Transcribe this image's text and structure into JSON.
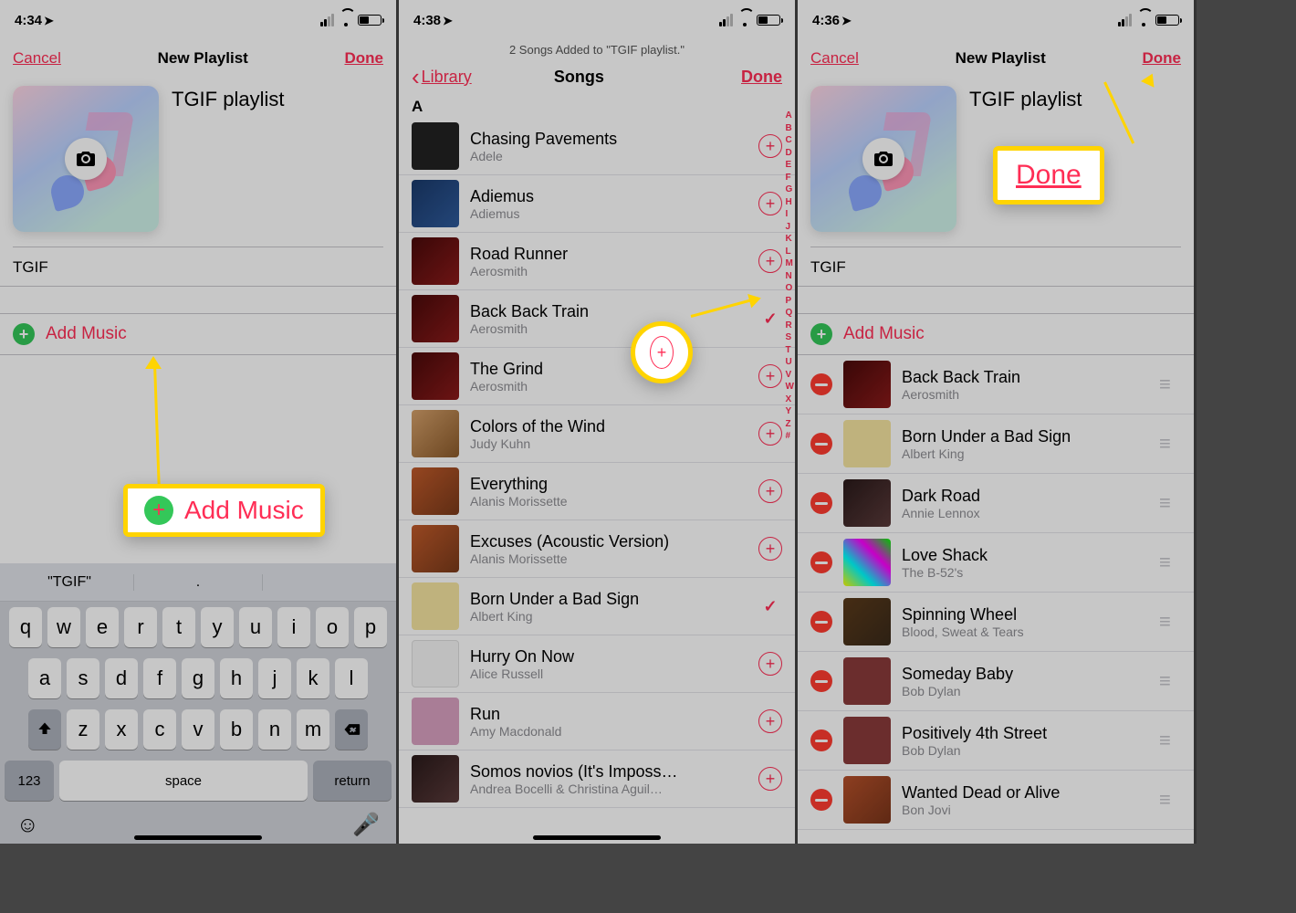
{
  "screens": {
    "s1": {
      "status_time": "4:34",
      "nav": {
        "cancel": "Cancel",
        "title": "New Playlist",
        "done": "Done"
      },
      "playlist_title": "TGIF playlist",
      "description": "TGIF",
      "add_music": "Add Music",
      "callout_add_music": "Add Music",
      "keyboard": {
        "suggestion": "\"TGIF\"",
        "row1": [
          "q",
          "w",
          "e",
          "r",
          "t",
          "y",
          "u",
          "i",
          "o",
          "p"
        ],
        "row2": [
          "a",
          "s",
          "d",
          "f",
          "g",
          "h",
          "j",
          "k",
          "l"
        ],
        "row3": [
          "z",
          "x",
          "c",
          "v",
          "b",
          "n",
          "m"
        ],
        "key_123": "123",
        "key_space": "space",
        "key_return": "return"
      }
    },
    "s2": {
      "status_time": "4:38",
      "toast": "2 Songs Added to \"TGIF playlist.\"",
      "nav": {
        "back": "Library",
        "title": "Songs",
        "done": "Done"
      },
      "section": "A",
      "index": [
        "A",
        "B",
        "C",
        "D",
        "E",
        "F",
        "G",
        "H",
        "I",
        "J",
        "K",
        "L",
        "M",
        "N",
        "O",
        "P",
        "Q",
        "R",
        "S",
        "T",
        "U",
        "V",
        "W",
        "X",
        "Y",
        "Z",
        "#"
      ],
      "songs": [
        {
          "title": "Chasing Pavements",
          "artist": "Adele",
          "state": "add",
          "thumb": "t-adele"
        },
        {
          "title": "Adiemus",
          "artist": "Adiemus",
          "state": "add",
          "thumb": "t-blue"
        },
        {
          "title": "Road Runner",
          "artist": "Aerosmith",
          "state": "add",
          "thumb": "t-red"
        },
        {
          "title": "Back Back Train",
          "artist": "Aerosmith",
          "state": "added",
          "thumb": "t-red"
        },
        {
          "title": "The Grind",
          "artist": "Aerosmith",
          "state": "add",
          "thumb": "t-red"
        },
        {
          "title": "Colors of the Wind",
          "artist": "Judy Kuhn",
          "state": "add",
          "thumb": "t-poca"
        },
        {
          "title": "Everything",
          "artist": "Alanis Morissette",
          "state": "add",
          "thumb": "t-alanis"
        },
        {
          "title": "Excuses (Acoustic Version)",
          "artist": "Alanis Morissette",
          "state": "add",
          "thumb": "t-alanis"
        },
        {
          "title": "Born Under a Bad Sign",
          "artist": "Albert King",
          "state": "added",
          "thumb": "t-king"
        },
        {
          "title": "Hurry On Now",
          "artist": "Alice Russell",
          "state": "add",
          "thumb": "t-white"
        },
        {
          "title": "Run",
          "artist": "Amy Macdonald",
          "state": "add",
          "thumb": "t-amy"
        },
        {
          "title": "Somos novios (It's Imposs…",
          "artist": "Andrea Bocelli & Christina Aguil…",
          "state": "add",
          "thumb": "t-dark"
        }
      ]
    },
    "s3": {
      "status_time": "4:36",
      "nav": {
        "cancel": "Cancel",
        "title": "New Playlist",
        "done": "Done"
      },
      "playlist_title": "TGIF playlist",
      "description": "TGIF",
      "add_music": "Add Music",
      "callout_done": "Done",
      "songs": [
        {
          "title": "Back Back Train",
          "artist": "Aerosmith",
          "thumb": "t-red"
        },
        {
          "title": "Born Under a Bad Sign",
          "artist": "Albert King",
          "thumb": "t-king"
        },
        {
          "title": "Dark Road",
          "artist": "Annie Lennox",
          "thumb": "t-dark"
        },
        {
          "title": "Love Shack",
          "artist": "The B-52's",
          "thumb": "t-b52"
        },
        {
          "title": "Spinning Wheel",
          "artist": "Blood, Sweat & Tears",
          "thumb": "t-bst"
        },
        {
          "title": "Someday Baby",
          "artist": "Bob Dylan",
          "thumb": "t-dylan"
        },
        {
          "title": "Positively 4th Street",
          "artist": "Bob Dylan",
          "thumb": "t-dylan"
        },
        {
          "title": "Wanted Dead or Alive",
          "artist": "Bon Jovi",
          "thumb": "t-bj"
        }
      ]
    }
  }
}
